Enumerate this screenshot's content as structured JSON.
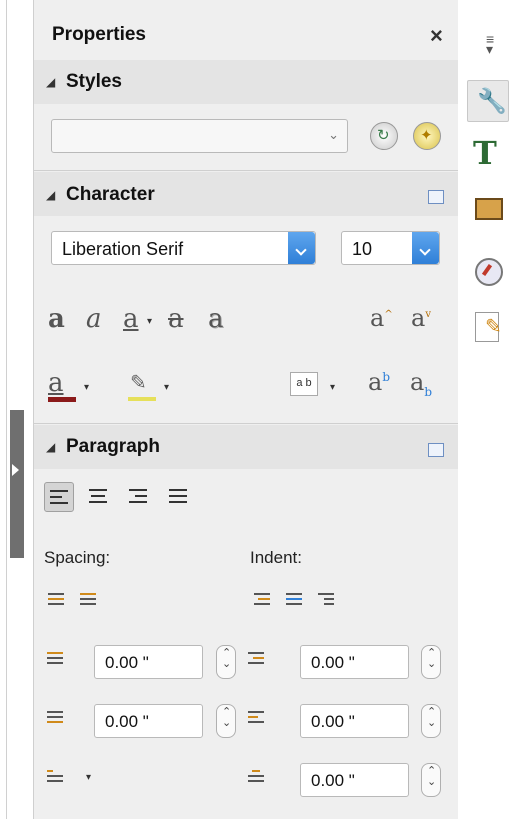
{
  "panel": {
    "title": "Properties",
    "close_glyph": "×"
  },
  "styles": {
    "title": "Styles",
    "combo_value": "",
    "update_icon": "update-style-icon",
    "new_icon": "new-style-icon"
  },
  "character": {
    "title": "Character",
    "font_name": "Liberation Serif",
    "font_size": "10",
    "format_icons": [
      "bold-icon",
      "italic-icon",
      "underline-icon",
      "strikethrough-icon",
      "shadow-icon",
      "increase-size-icon",
      "decrease-size-icon"
    ],
    "color_icons": [
      "font-color-icon",
      "highlight-color-icon",
      "character-spacing-icon",
      "superscript-icon",
      "subscript-icon"
    ]
  },
  "paragraph": {
    "title": "Paragraph",
    "align_icons": [
      "align-left-icon",
      "align-center-icon",
      "align-right-icon",
      "justify-icon"
    ],
    "spacing_label": "Spacing:",
    "indent_label": "Indent:",
    "above_spacing": "0.00 \"",
    "below_spacing": "0.00 \"",
    "before_indent": "0.00 \"",
    "after_indent": "0.00 \"",
    "first_line_indent": "0.00 \""
  },
  "tabs": [
    "properties-icon",
    "styles-icon",
    "gallery-icon",
    "navigator-icon",
    "manage-changes-icon"
  ],
  "colors": {
    "panel_bg": "#efefef",
    "section_bg": "#e4e4e4",
    "accent_blue": "#2f7fd7",
    "font_color_bar": "#8b1a1a"
  }
}
